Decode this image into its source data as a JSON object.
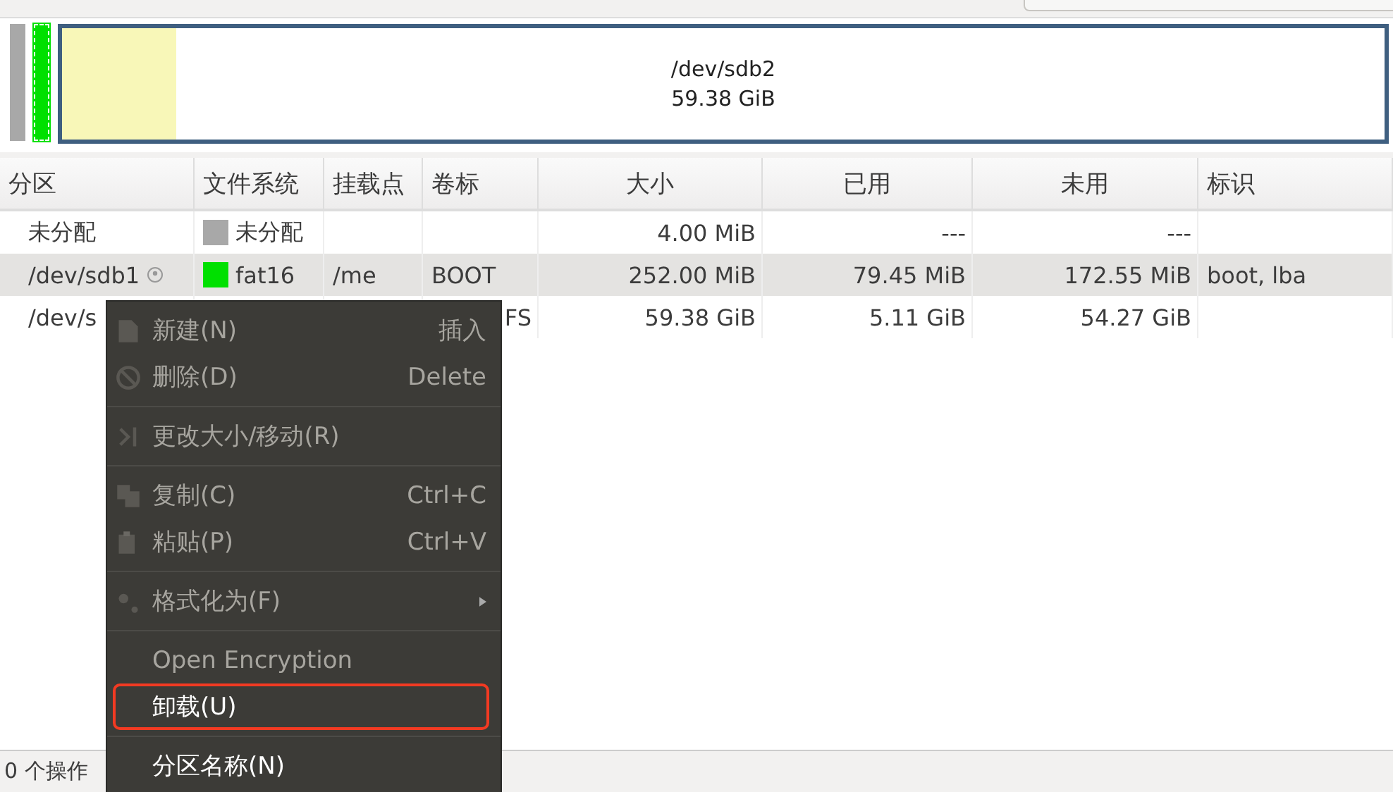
{
  "partition_map": {
    "selected_name": "/dev/sdb2",
    "selected_size": "59.38 GiB",
    "level": 0.086
  },
  "table": {
    "columns": [
      "分区",
      "文件系统",
      "挂载点",
      "卷标",
      "大小",
      "已用",
      "未用",
      "标识"
    ],
    "rows": [
      {
        "partition": "未分配",
        "color": "#a8a8a8",
        "filesystem": "未分配",
        "size": "4.00 MiB",
        "used": "---",
        "unused": "---",
        "mounted": false,
        "selected": false
      },
      {
        "partition": "/dev/sdb1",
        "color": "#00e000",
        "filesystem": "fat16",
        "mount": "/me",
        "label": "BOOT",
        "size": "252.00 MiB",
        "used": "79.45 MiB",
        "unused": "172.55 MiB",
        "flags": "boot, lba",
        "mounted": true,
        "selected": true
      },
      {
        "partition": "/dev/s",
        "label": "FS",
        "size": "59.38 GiB",
        "used": "5.11 GiB",
        "unused": "54.27 GiB",
        "mounted": false,
        "selected": false
      }
    ]
  },
  "context_menu": {
    "items": [
      {
        "kind": "item",
        "label": "新建(N)",
        "shortcut": "插入",
        "disabled": true,
        "highlighted": false
      },
      {
        "kind": "item",
        "label": "删除(D)",
        "shortcut": "Delete",
        "disabled": true,
        "highlighted": false
      },
      {
        "kind": "separator"
      },
      {
        "kind": "item",
        "label": "更改大小/移动(R)",
        "disabled": true,
        "highlighted": false
      },
      {
        "kind": "separator"
      },
      {
        "kind": "item",
        "label": "复制(C)",
        "shortcut": "Ctrl+C",
        "disabled": true,
        "highlighted": false
      },
      {
        "kind": "item",
        "label": "粘贴(P)",
        "shortcut": "Ctrl+V",
        "disabled": true,
        "highlighted": false
      },
      {
        "kind": "separator"
      },
      {
        "kind": "submenu",
        "label": "格式化为(F)",
        "disabled": true,
        "highlighted": false
      },
      {
        "kind": "separator"
      },
      {
        "kind": "item",
        "label": "Open Encryption",
        "disabled": true,
        "highlighted": false
      },
      {
        "kind": "item",
        "label": "卸载(U)",
        "disabled": false,
        "highlighted": true
      },
      {
        "kind": "separator"
      },
      {
        "kind": "item",
        "label": "分区名称(N)",
        "disabled": false,
        "highlighted": false
      }
    ]
  },
  "status_bar": {
    "text": "0 个操作"
  }
}
